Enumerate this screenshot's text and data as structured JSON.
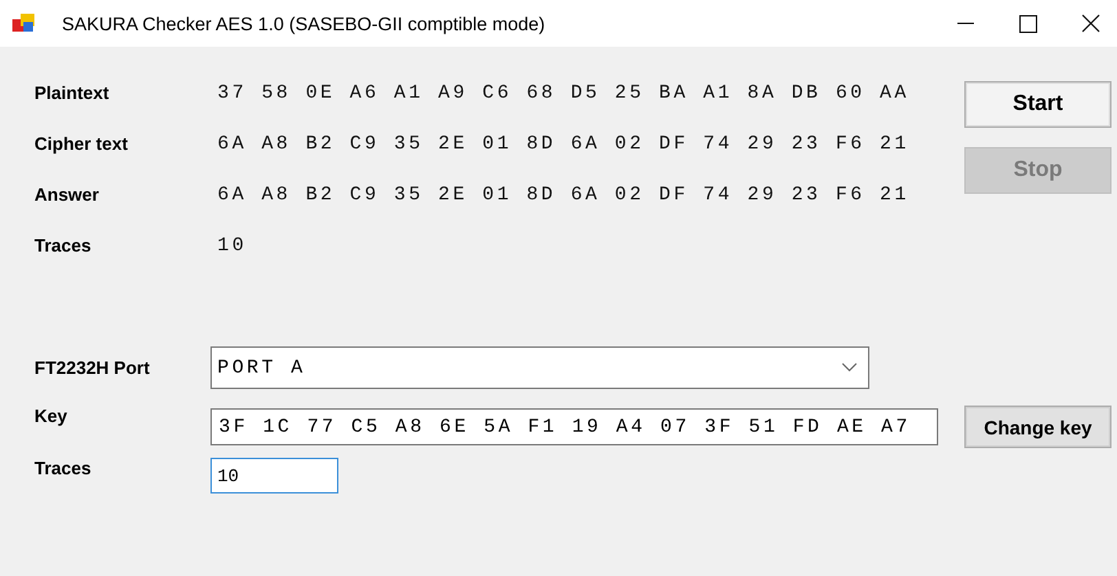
{
  "window": {
    "title": "SAKURA Checker AES 1.0 (SASEBO-GII comptible mode)"
  },
  "results": [
    {
      "label": "Plaintext",
      "value": "37 58 0E A6 A1 A9 C6 68 D5 25 BA A1 8A DB 60 AA"
    },
    {
      "label": "Cipher text",
      "value": "6A A8 B2 C9 35 2E 01 8D 6A 02 DF 74 29 23 F6 21"
    },
    {
      "label": "Answer",
      "value": "6A A8 B2 C9 35 2E 01 8D 6A 02 DF 74 29 23 F6 21"
    },
    {
      "label": "Traces",
      "value": "10"
    }
  ],
  "buttons": [
    {
      "label": "Start",
      "disabled": false
    },
    {
      "label": "Stop",
      "disabled": true
    }
  ],
  "settings": {
    "port": {
      "label": "FT2232H Port",
      "value": "PORT A"
    },
    "key": {
      "label": "Key",
      "value": "3F 1C 77 C5 A8 6E 5A F1 19 A4 07 3F 51 FD AE A7"
    },
    "change_key_button": {
      "label": "Change key"
    },
    "traces": {
      "label": "Traces",
      "value": "10",
      "focused": true
    }
  }
}
